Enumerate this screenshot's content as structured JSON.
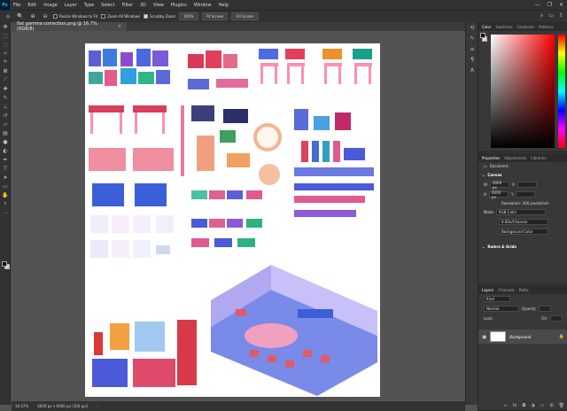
{
  "app": {
    "logo": "Ps",
    "window_controls": [
      "—",
      "❐",
      "✕"
    ]
  },
  "menu": [
    "File",
    "Edit",
    "Image",
    "Layer",
    "Type",
    "Select",
    "Filter",
    "3D",
    "View",
    "Plugins",
    "Window",
    "Help"
  ],
  "options": {
    "resize_windows": "Resize Windows to Fit",
    "zoom_all": "Zoom All Windows",
    "scrubby_zoom": "Scrubby Zoom",
    "zoom_100": "100%",
    "fit_screen": "Fit Screen",
    "fill_screen": "Fill Screen"
  },
  "document": {
    "tab_title": "flat gamma correction.png @ 16.7% (RGB/8)",
    "zoom": "16.67%",
    "dims": "6000 px x 6000 px (300 ppi)"
  },
  "color_panel": {
    "tabs": [
      "Color",
      "Swatches",
      "Gradients",
      "Patterns"
    ],
    "fg": "#111111",
    "bg": "#f7cce8"
  },
  "properties": {
    "tabs": [
      "Properties",
      "Adjustments",
      "Libraries"
    ],
    "doc_label": "Document",
    "canvas_head": "Canvas",
    "w_label": "W",
    "w_value": "6000 px",
    "h_label": "H",
    "h_value": "6000 px",
    "resolution": "Resolution: 300 pixels/inch",
    "mode_label": "Mode",
    "mode_value": "RGB Color",
    "depth_value": "8 Bits/Channel",
    "bg_color": "Background Color",
    "rulers_head": "Rulers & Grids"
  },
  "layers_panel": {
    "tabs": [
      "Layers",
      "Channels",
      "Paths"
    ],
    "kind": "Kind",
    "blend": "Normal",
    "opacity": "Opacity:",
    "lock": "Lock:",
    "fill": "Fill:",
    "layer_name": "Background"
  }
}
